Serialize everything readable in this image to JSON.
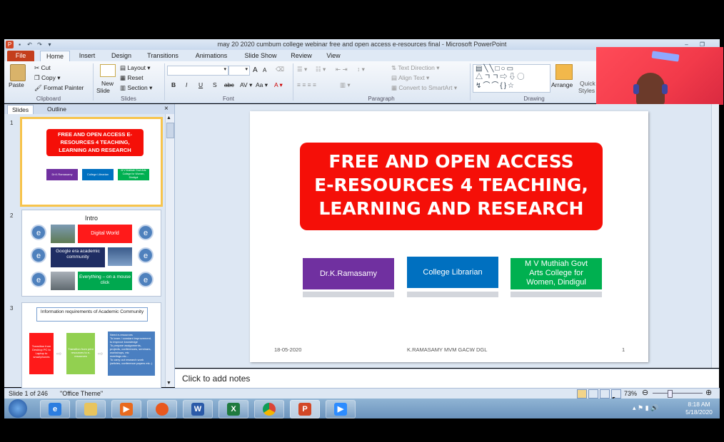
{
  "window": {
    "title": "may 20 2020 cumbum college webinar free and open access e-resources final  -  Microsoft PowerPoint"
  },
  "tabs": [
    "File",
    "Home",
    "Insert",
    "Design",
    "Transitions",
    "Animations",
    "Slide Show",
    "Review",
    "View"
  ],
  "ribbon": {
    "clipboard": {
      "paste": "Paste",
      "cut": "Cut",
      "copy": "Copy",
      "format_painter": "Format Painter",
      "group": "Clipboard"
    },
    "slides": {
      "new_slide": "New",
      "new_slide2": "Slide",
      "layout": "Layout",
      "reset": "Reset",
      "section": "Section",
      "group": "Slides"
    },
    "font": {
      "group": "Font",
      "bold": "B",
      "italic": "I",
      "underline": "U",
      "strike": "S",
      "abc": "abc",
      "aa": "Aa",
      "a_grow": "A",
      "a_shrink": "A"
    },
    "paragraph": {
      "group": "Paragraph",
      "text_direction": "Text Direction",
      "align_text": "Align Text",
      "convert_smartart": "Convert to SmartArt"
    },
    "drawing": {
      "group": "Drawing",
      "arrange": "Arrange",
      "quick_styles": "Quick",
      "quick_styles2": "Styles"
    }
  },
  "left_panel": {
    "tabs": [
      "Slides",
      "Outline"
    ],
    "slides": [
      {
        "num": "1",
        "title": "FREE AND OPEN ACCESS E-RESOURCES 4 TEACHING, LEARNING AND RESEARCH",
        "boxes": [
          "Dr.K.Ramasamy",
          "College Librarian",
          "M V Muthiah Govt Arts College for Women, Dindigul"
        ]
      },
      {
        "num": "2",
        "title": "Intro",
        "items": [
          "Digital World",
          "Google era academic community",
          "Everything – on a mouse click"
        ],
        "e": "e"
      },
      {
        "num": "3",
        "title": "Information requirements of Academic Community",
        "flow": [
          "Transition from Desktop PC to Laptop to smartphones",
          "Transition from print resources to e-resources",
          "Need e-resources"
        ],
        "bullets": [
          "To learn / constant improvement, to improve knowledge",
          "To prepare assignments, projects, conferences, seminars, workshops, etc",
          "meetings etc...",
          "To carry out research work (articles, conference papers etc..)"
        ]
      }
    ]
  },
  "slide": {
    "title_lines": [
      "FREE AND OPEN ACCESS",
      "E-RESOURCES 4 TEACHING,",
      "LEARNING AND RESEARCH"
    ],
    "author": "Dr.K.Ramasamy",
    "role": "College Librarian",
    "college_lines": [
      "M V Muthiah Govt",
      "Arts College for",
      "Women, Dindigul"
    ],
    "footer_date": "18-05-2020",
    "footer_center": "K.RAMASAMY MVM GACW DGL",
    "footer_page": "1",
    "colors": {
      "title_bg": "#f50f08",
      "author_bg": "#7030a0",
      "role_bg": "#0070c0",
      "college_bg": "#00b050"
    }
  },
  "notes": {
    "placeholder": "Click to add notes"
  },
  "status": {
    "slide_info": "Slide 1 of 246",
    "theme": "\"Office Theme\"",
    "zoom": "73%"
  },
  "taskbar": {
    "time": "8:18 AM",
    "date": "5/18/2020",
    "apps": [
      "start-orb",
      "internet-explorer",
      "file-explorer",
      "media-player",
      "firefox",
      "word",
      "excel",
      "chrome",
      "powerpoint",
      "zoom"
    ]
  }
}
